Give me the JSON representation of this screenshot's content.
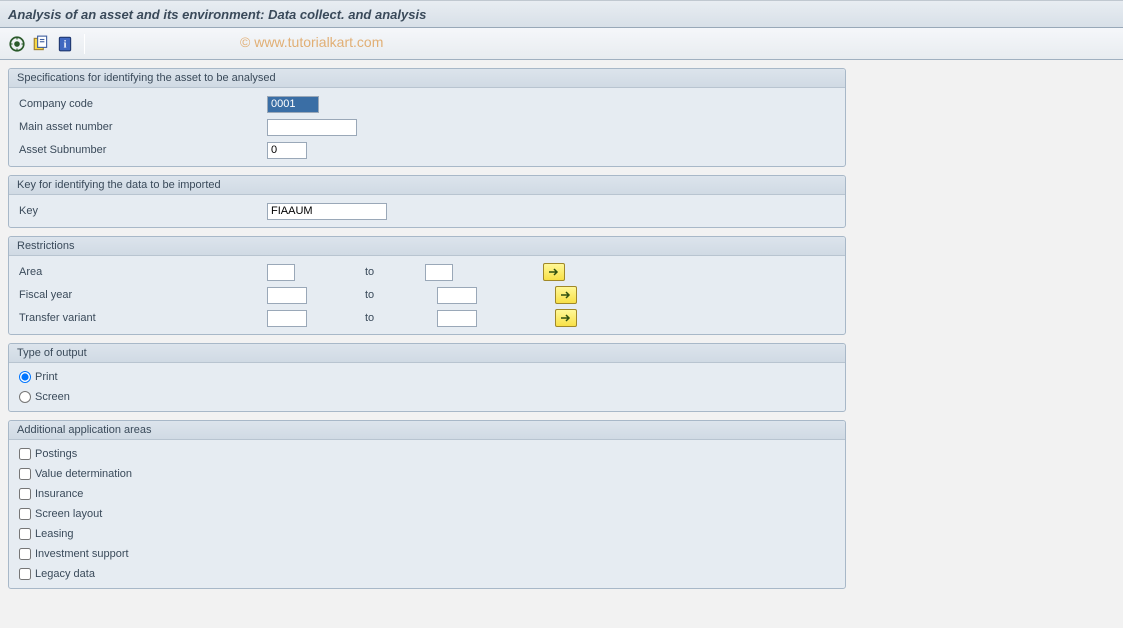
{
  "title": "Analysis of an asset and its environment: Data collect. and analysis",
  "watermark": "© www.tutorialkart.com",
  "groups": {
    "spec": {
      "title": "Specifications for identifying the asset to be analysed",
      "company_code_label": "Company code",
      "company_code_value": "0001",
      "main_asset_label": "Main asset number",
      "main_asset_value": "",
      "sub_label": "Asset Subnumber",
      "sub_value": "0"
    },
    "key": {
      "title": "Key for identifying the data to be imported",
      "key_label": "Key",
      "key_value": "FIAAUM"
    },
    "restrictions": {
      "title": "Restrictions",
      "area_label": "Area",
      "fiscal_label": "Fiscal year",
      "transfer_label": "Transfer variant",
      "to_label": "to"
    },
    "output": {
      "title": "Type of output",
      "print_label": "Print",
      "screen_label": "Screen"
    },
    "additional": {
      "title": "Additional application areas",
      "items": [
        "Postings",
        "Value determination",
        "Insurance",
        "Screen layout",
        "Leasing",
        "Investment support",
        "Legacy data"
      ]
    }
  }
}
